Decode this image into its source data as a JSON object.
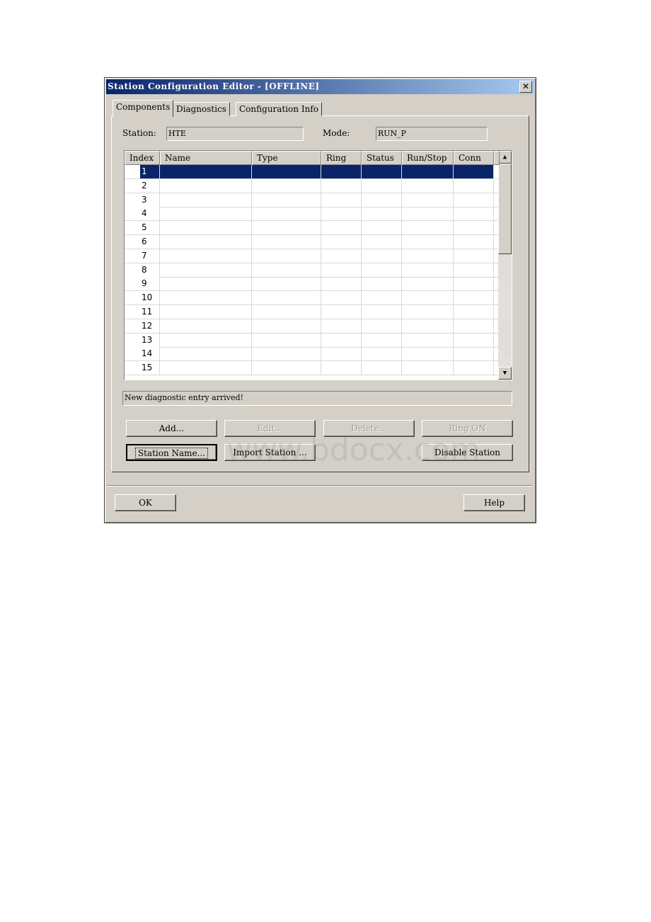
{
  "window": {
    "title": "Station Configuration Editor - [OFFLINE]",
    "close_icon": "close-icon"
  },
  "tabs": [
    {
      "label": "Components",
      "active": true
    },
    {
      "label": "Diagnostics"
    },
    {
      "label": "Configuration Info"
    }
  ],
  "station": {
    "label": "Station:",
    "value": "HTE"
  },
  "mode": {
    "label": "Mode:",
    "value": "RUN_P"
  },
  "table": {
    "columns": [
      "Index",
      "Name",
      "Type",
      "Ring",
      "Status",
      "Run/Stop",
      "Conn"
    ],
    "rows": [
      "1",
      "2",
      "3",
      "4",
      "5",
      "6",
      "7",
      "8",
      "9",
      "10",
      "11",
      "12",
      "13",
      "14",
      "15"
    ],
    "selected_index": "1"
  },
  "status_message": "New diagnostic entry arrived!",
  "buttons": {
    "add": "Add...",
    "edit": "Edit...",
    "delete": "Delete...",
    "ring_on": "Ring ON",
    "station_name": "Station Name...",
    "import_station": "Import Station ...",
    "disable_station": "Disable Station",
    "ok": "OK",
    "help": "Help"
  },
  "watermark": "www.bdocx.com",
  "colors": {
    "titlebar": "#0a246a",
    "selection": "#0a246a",
    "face": "#d4d0c8"
  }
}
